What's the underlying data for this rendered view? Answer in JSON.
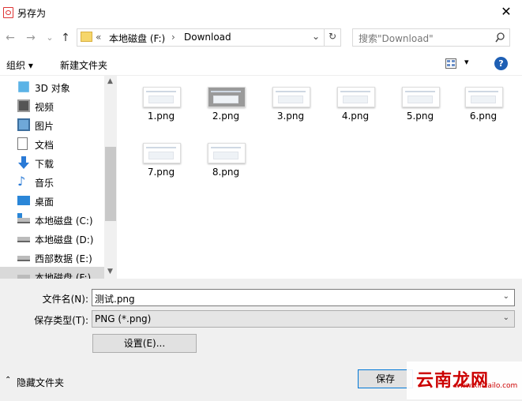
{
  "window": {
    "title": "另存为",
    "close_glyph": "✕"
  },
  "nav": {
    "back": "←",
    "forward": "→",
    "down": "⌄",
    "up": "↑"
  },
  "address": {
    "prefix": "«",
    "crumbs": [
      "本地磁盘 (F:)",
      "Download"
    ],
    "separator": "›",
    "dropdown": "⌄",
    "refresh": "↻"
  },
  "search": {
    "placeholder": "搜索\"Download\"",
    "icon": "search-icon"
  },
  "toolbar": {
    "organize": "组织 ▾",
    "new_folder": "新建文件夹",
    "view": "▾",
    "help": "?"
  },
  "sidebar": {
    "items": [
      {
        "label": "3D 对象",
        "icon": "3d-objects-icon"
      },
      {
        "label": "视频",
        "icon": "video-icon"
      },
      {
        "label": "图片",
        "icon": "pictures-icon"
      },
      {
        "label": "文档",
        "icon": "documents-icon"
      },
      {
        "label": "下载",
        "icon": "download-icon"
      },
      {
        "label": "音乐",
        "icon": "music-icon"
      },
      {
        "label": "桌面",
        "icon": "desktop-icon"
      },
      {
        "label": "本地磁盘 (C:)",
        "icon": "drive-icon"
      },
      {
        "label": "本地磁盘 (D:)",
        "icon": "drive-icon"
      },
      {
        "label": "西部数据 (E:)",
        "icon": "drive-icon"
      },
      {
        "label": "本地磁盘 (F:)",
        "icon": "drive-icon",
        "selected": true
      }
    ]
  },
  "files": [
    "1.png",
    "2.png",
    "3.png",
    "4.png",
    "5.png",
    "6.png",
    "7.png",
    "8.png"
  ],
  "form": {
    "filename_label": "文件名(N):",
    "filename_value": "测试.png",
    "filetype_label": "保存类型(T):",
    "filetype_value": "PNG (*.png)",
    "settings_button": "设置(E)..."
  },
  "footer": {
    "hide_folders": "隐藏文件夹",
    "save_button": "保存"
  },
  "watermark": {
    "text": "云南龙网",
    "url": "www.xlhzailo.com"
  }
}
